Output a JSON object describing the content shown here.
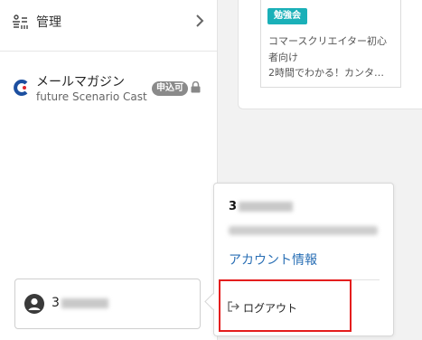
{
  "nav": {
    "manage_label": "管理"
  },
  "mail_magazine": {
    "title": "メールマガジン",
    "subtitle": "future Scenario Cast",
    "badge": "申込可"
  },
  "user_box": {
    "name_visible": "3"
  },
  "card": {
    "tag": "勉強会",
    "lines": [
      "コマースクリエイター初心",
      "者向け",
      "2時間でわかる！カンタ…"
    ]
  },
  "popover": {
    "name_visible": "3",
    "account_link": "アカウント情報",
    "logout_label": "ログアウト"
  },
  "colors": {
    "tag_bg": "#1ab0b8",
    "link": "#2a6fb5",
    "highlight": "#e41e1e",
    "badge_bg": "#8a8a8a"
  }
}
